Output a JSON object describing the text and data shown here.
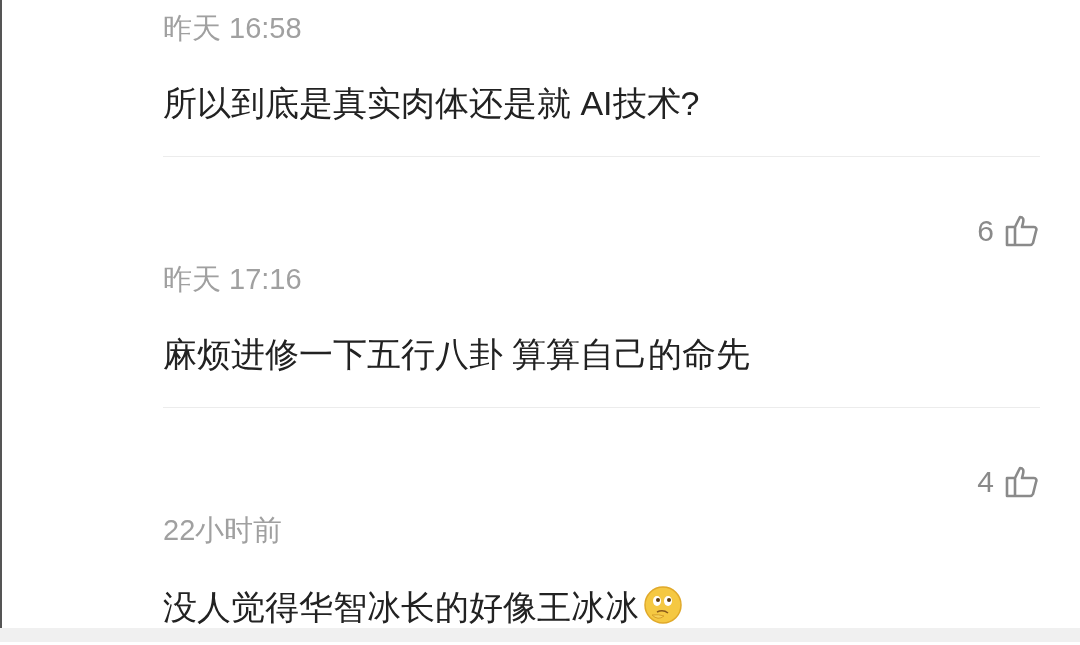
{
  "comments": [
    {
      "time": "昨天 16:58",
      "text": "所以到底是真实肉体还是就 AI技术?"
    },
    {
      "likes": "6",
      "time": "昨天 17:16",
      "text": "麻烦进修一下五行八卦 算算自己的命先"
    },
    {
      "likes": "4",
      "time": "22小时前",
      "text": "没人觉得华智冰长的好像王冰冰",
      "emoji": true
    }
  ]
}
